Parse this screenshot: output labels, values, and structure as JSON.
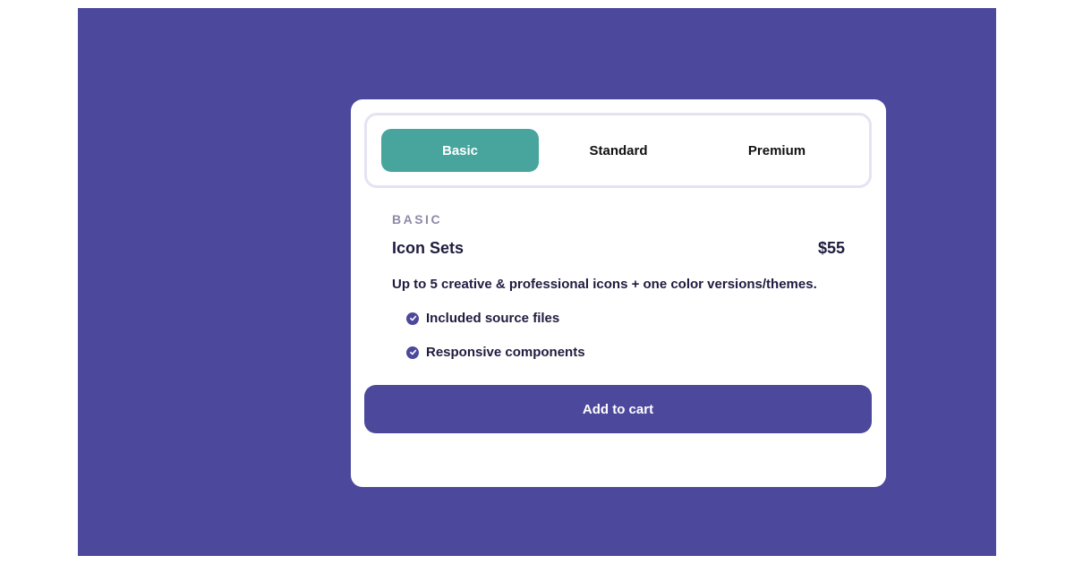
{
  "tabs": {
    "basic": "Basic",
    "standard": "Standard",
    "premium": "Premium",
    "active": "Basic"
  },
  "plan": {
    "kicker": "BASIC",
    "name": "Icon Sets",
    "price": "$55",
    "description": "Up to 5 creative & professional icons + one color versions/themes.",
    "features": [
      "Included source files",
      "Responsive components"
    ]
  },
  "cart_button": "Add to cart",
  "colors": {
    "backdrop": "#4c489c",
    "active_tab": "#47a59e",
    "text": "#1f1c3f",
    "kicker": "#8d8aa8"
  },
  "icons": {
    "feature_bullet": "check-circle-icon"
  }
}
